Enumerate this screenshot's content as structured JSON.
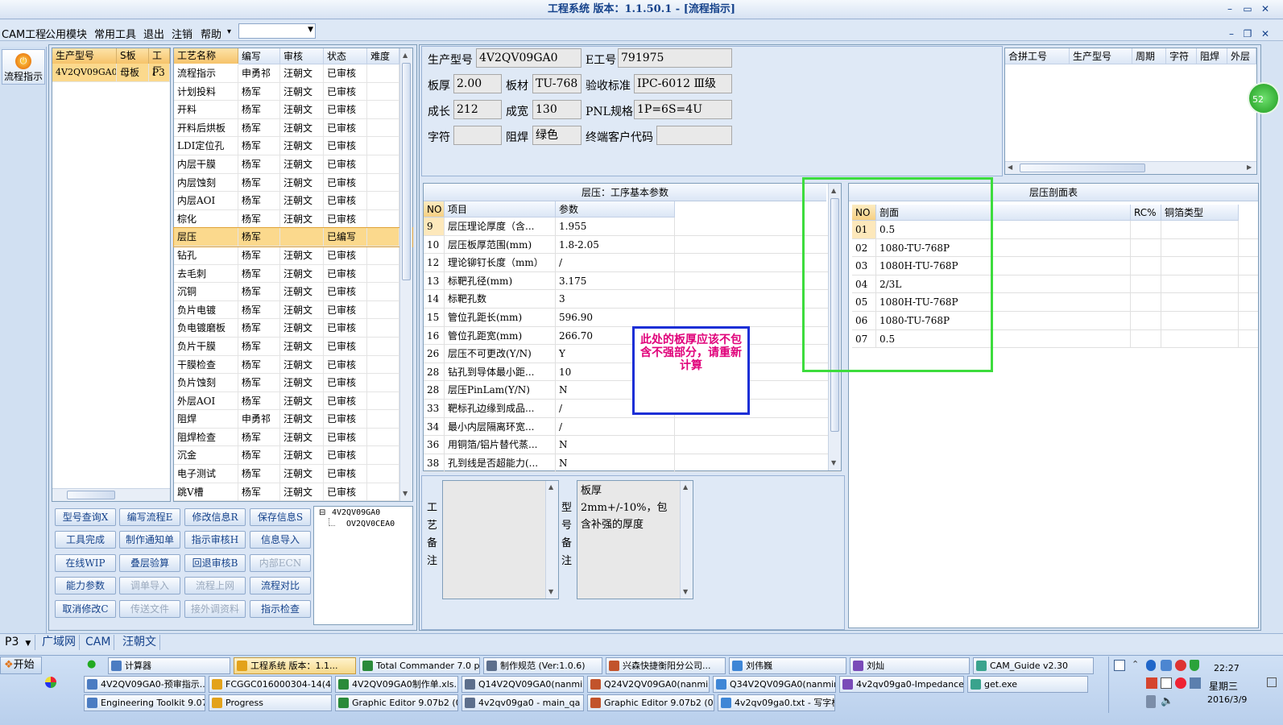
{
  "window": {
    "title": "工程系统  版本：1.1.50.1 - [流程指示]",
    "min": "–",
    "max": "▭",
    "close": "✕"
  },
  "menu": {
    "items": [
      "CAM工程",
      "公用模块",
      "常用工具",
      "退出",
      "注销",
      "帮助"
    ],
    "help_arrow": "▾",
    "combo_value": ""
  },
  "mdi": {
    "min": "–",
    "restore": "❐",
    "close": "✕"
  },
  "left": {
    "flow_label": "流程指示",
    "flow_icon": "power-icon"
  },
  "model_list": {
    "headers": [
      "生产型号",
      "S板",
      "工厂"
    ],
    "rows": [
      [
        "4V2QV09GA0",
        "母板",
        "P3"
      ]
    ]
  },
  "process_table": {
    "headers": [
      "工艺名称",
      "编写",
      "审核",
      "状态",
      "难度"
    ],
    "rows": [
      [
        "流程指示",
        "申勇祁",
        "汪朝文",
        "已审核",
        ""
      ],
      [
        "计划投料",
        "杨军",
        "汪朝文",
        "已审核",
        ""
      ],
      [
        "开料",
        "杨军",
        "汪朝文",
        "已审核",
        ""
      ],
      [
        "开料后烘板",
        "杨军",
        "汪朝文",
        "已审核",
        ""
      ],
      [
        "LDI定位孔",
        "杨军",
        "汪朝文",
        "已审核",
        ""
      ],
      [
        "内层干膜",
        "杨军",
        "汪朝文",
        "已审核",
        ""
      ],
      [
        "内层蚀刻",
        "杨军",
        "汪朝文",
        "已审核",
        ""
      ],
      [
        "内层AOI",
        "杨军",
        "汪朝文",
        "已审核",
        ""
      ],
      [
        "棕化",
        "杨军",
        "汪朝文",
        "已审核",
        ""
      ],
      [
        "层压",
        "杨军",
        "",
        "已编写",
        ""
      ],
      [
        "钻孔",
        "杨军",
        "汪朝文",
        "已审核",
        ""
      ],
      [
        "去毛刺",
        "杨军",
        "汪朝文",
        "已审核",
        ""
      ],
      [
        "沉铜",
        "杨军",
        "汪朝文",
        "已审核",
        ""
      ],
      [
        "负片电镀",
        "杨军",
        "汪朝文",
        "已审核",
        ""
      ],
      [
        "负电镀磨板",
        "杨军",
        "汪朝文",
        "已审核",
        ""
      ],
      [
        "负片干膜",
        "杨军",
        "汪朝文",
        "已审核",
        ""
      ],
      [
        "干膜检查",
        "杨军",
        "汪朝文",
        "已审核",
        ""
      ],
      [
        "负片蚀刻",
        "杨军",
        "汪朝文",
        "已审核",
        ""
      ],
      [
        "外层AOI",
        "杨军",
        "汪朝文",
        "已审核",
        ""
      ],
      [
        "阻焊",
        "申勇祁",
        "汪朝文",
        "已审核",
        ""
      ],
      [
        "阻焊检查",
        "杨军",
        "汪朝文",
        "已审核",
        ""
      ],
      [
        "沉金",
        "杨军",
        "汪朝文",
        "已审核",
        ""
      ],
      [
        "电子测试",
        "杨军",
        "汪朝文",
        "已审核",
        ""
      ],
      [
        "跳V槽",
        "杨军",
        "汪朝文",
        "已审核",
        ""
      ]
    ],
    "selected_index": 9
  },
  "buttons": [
    [
      {
        "label": "型号查询X",
        "disabled": false
      },
      {
        "label": "编写流程E",
        "disabled": false
      },
      {
        "label": "修改信息R",
        "disabled": false
      },
      {
        "label": "保存信息S",
        "disabled": false
      }
    ],
    [
      {
        "label": "工具完成",
        "disabled": false
      },
      {
        "label": "制作通知单",
        "disabled": false
      },
      {
        "label": "指示审核H",
        "disabled": false
      },
      {
        "label": "信息导入",
        "disabled": false
      }
    ],
    [
      {
        "label": "在线WIP",
        "disabled": false
      },
      {
        "label": "叠层验算",
        "disabled": false
      },
      {
        "label": "回退审核B",
        "disabled": false
      },
      {
        "label": "内部ECN",
        "disabled": true
      }
    ],
    [
      {
        "label": "能力参数",
        "disabled": false
      },
      {
        "label": "调单导入",
        "disabled": true
      },
      {
        "label": "流程上网",
        "disabled": true
      },
      {
        "label": "流程对比",
        "disabled": false
      }
    ],
    [
      {
        "label": "取消修改C",
        "disabled": false
      },
      {
        "label": "传送文件",
        "disabled": true
      },
      {
        "label": "接外调资料",
        "disabled": true
      },
      {
        "label": "指示检查",
        "disabled": false
      }
    ]
  ],
  "tree": {
    "root": "4V2QV09GA0",
    "child": "OV2QV0CEA0",
    "expander": "⊟"
  },
  "info": {
    "model_label": "生产型号",
    "model": "4V2QV09GA0",
    "eno_label": "E工号",
    "eno": "791975",
    "thick_label": "板厚",
    "thick": "2.00",
    "material_label": "板材",
    "material": "TU-768",
    "std_label": "验收标准",
    "std": "IPC-6012 Ⅲ级",
    "len_label": "成长",
    "len": "212",
    "wid_label": "成宽",
    "wid": "130",
    "pnl_label": "PNL规格",
    "pnl": "1P=6S=4U",
    "char_label": "字符",
    "char": "",
    "mask_label": "阻焊",
    "mask": "绿色",
    "cust_label": "终端客户代码",
    "cust": ""
  },
  "merge_table": {
    "headers": [
      "合拼工号",
      "生产型号",
      "周期",
      "字符",
      "阻焊",
      "外层"
    ],
    "badge": "52"
  },
  "params": {
    "title": "层压：工序基本参数",
    "headers": [
      "NO",
      "项目",
      "参数"
    ],
    "rows": [
      [
        "9",
        "层压理论厚度（含...",
        "1.955"
      ],
      [
        "10",
        "层压板厚范围(mm)",
        "1.8-2.05"
      ],
      [
        "12",
        "理论铆钉长度（mm）",
        "/"
      ],
      [
        "13",
        "标靶孔径(mm)",
        "3.175"
      ],
      [
        "14",
        "标靶孔数",
        "3"
      ],
      [
        "15",
        "管位孔距长(mm)",
        "596.90"
      ],
      [
        "16",
        "管位孔距宽(mm)",
        "266.70"
      ],
      [
        "26",
        "层压不可更改(Y/N)",
        "Y"
      ],
      [
        "28",
        "钻孔到导体最小距...",
        "10"
      ],
      [
        "28",
        "层压PinLam(Y/N)",
        "N"
      ],
      [
        "33",
        "靶标孔边缘到成品...",
        "/"
      ],
      [
        "34",
        "最小内层隔离环宽...",
        "/"
      ],
      [
        "36",
        "用铜箔/铝片替代蒸...",
        "N"
      ],
      [
        "38",
        "孔到线是否超能力(...",
        "N"
      ]
    ]
  },
  "annotation": {
    "text": "此处的板厚应该不包含不强部分，请重新计算"
  },
  "section": {
    "title": "层压剖面表",
    "headers": [
      "NO",
      "剖面",
      "RC%",
      "铜箔类型"
    ],
    "rows": [
      [
        "01",
        "0.5",
        "",
        ""
      ],
      [
        "02",
        "1080-TU-768P",
        "",
        ""
      ],
      [
        "03",
        "1080H-TU-768P",
        "",
        ""
      ],
      [
        "04",
        "2/3L",
        "",
        ""
      ],
      [
        "05",
        "1080H-TU-768P",
        "",
        ""
      ],
      [
        "06",
        "1080-TU-768P",
        "",
        ""
      ],
      [
        "07",
        "0.5",
        "",
        ""
      ]
    ]
  },
  "notes": {
    "craft_label": "工艺备注",
    "craft_text": "",
    "model_label": "型号备注",
    "model_text": "板厚2mm+/-10%，包含补强的厚度"
  },
  "statusbar": {
    "combo": "P3",
    "tabs": [
      "广域网",
      "CAM",
      "汪朝文"
    ]
  },
  "taskbar": {
    "start": "开始",
    "row1": [
      "计算器",
      "工程系统  版本：1.1...",
      "Total Commander 7.0 p...",
      "制作规范 (Ver:1.0.6)",
      "兴森快捷衡阳分公司...",
      "刘伟巍",
      "刘灿",
      "CAM_Guide v2.30"
    ],
    "row2": [
      "4V2QV09GA0-预审指示...",
      "FCGGC016000304-14(4...",
      "4V2QV09GA0制作单.xls...",
      "Q14V2QV09GA0(nanmin...",
      "Q24V2QV09GA0(nanmin...",
      "Q34V2QV09GA0(nanmin...",
      "4v2qv09ga0-Impedance...",
      "get.exe"
    ],
    "row3": [
      "Engineering Toolkit 9.07...",
      "Progress",
      "Graphic Editor 9.07b2 (0...",
      "4v2qv09ga0 - main_qa",
      "Graphic Editor 9.07b2 (0...",
      "4v2qv09ga0.txt - 写字板"
    ],
    "time": "22:27",
    "weekday": "星期三",
    "date": "2016/3/9"
  },
  "colors": {
    "selected_row": "#fbd98d",
    "annotation_text": "#e0007a",
    "annotation_border": "#1c2fd6",
    "highlight_box": "#3ddc3d"
  }
}
